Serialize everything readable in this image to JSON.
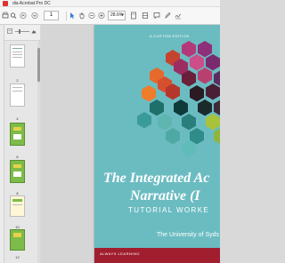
{
  "window": {
    "title": "dia Acrobat Pro DC"
  },
  "toolbar": {
    "page_number": "1",
    "zoom": "28.6%"
  },
  "thumbnails": [
    {
      "label": "2"
    },
    {
      "label": "4"
    },
    {
      "label": "6"
    },
    {
      "label": "8"
    },
    {
      "label": "10"
    },
    {
      "label": "12"
    }
  ],
  "cover": {
    "custom_label": "A CUSTOM EDITION",
    "title_line1": "The Integrated Ac",
    "title_line2": "Narrative (I",
    "subtitle": "TUTORIAL WORKE",
    "university": "The University of Syds",
    "footer": "ALWAYS LEARNING"
  },
  "colors": {
    "cover_background": "#6bbcc1",
    "footer_ribbon": "#a01e2e"
  }
}
